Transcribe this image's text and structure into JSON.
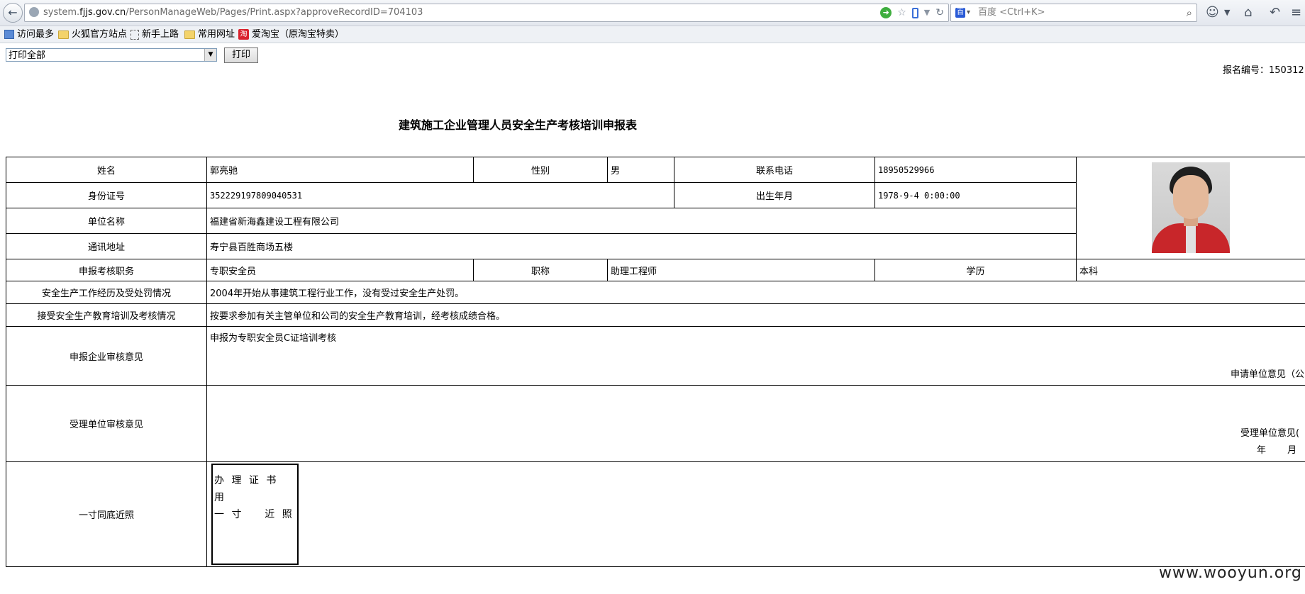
{
  "browser": {
    "url_prefix": "system.",
    "url_domain": "fjjs.gov.cn",
    "url_path": "/PersonManageWeb/Pages/Print.aspx?approveRecordID=704103",
    "search_placeholder": "百度 <Ctrl+K>"
  },
  "bookmarks": [
    {
      "label": "访问最多",
      "icon": "most-visited-icon"
    },
    {
      "label": "火狐官方站点",
      "icon": "folder-icon"
    },
    {
      "label": "新手上路",
      "icon": "page-icon"
    },
    {
      "label": "常用网址",
      "icon": "folder-icon"
    },
    {
      "label": "爱淘宝（原淘宝特卖）",
      "icon": "taobao-icon"
    }
  ],
  "toolbar": {
    "print_select_value": "打印全部",
    "print_button": "打印"
  },
  "reg_number": "报名编号：150312",
  "title": "建筑施工企业管理人员安全生产考核培训申报表",
  "form": {
    "name_label": "姓名",
    "name_value": "郭亮驰",
    "gender_label": "性别",
    "gender_value": "男",
    "phone_label": "联系电话",
    "phone_value": "18950529966",
    "id_label": "身份证号",
    "id_value": "352229197809040531",
    "birth_label": "出生年月",
    "birth_value": "1978-9-4 0:00:00",
    "company_label": "单位名称",
    "company_value": "福建省新海鑫建设工程有限公司",
    "address_label": "通讯地址",
    "address_value": "寿宁县百胜商场五楼",
    "position_label": "申报考核职务",
    "position_value": "专职安全员",
    "title_label": "职称",
    "title_value": "助理工程师",
    "edu_label": "学历",
    "edu_value": "本科",
    "experience_label": "安全生产工作经历及受处罚情况",
    "experience_value": "2004年开始从事建筑工程行业工作，没有受过安全生产处罚。",
    "training_label": "接受安全生产教育培训及考核情况",
    "training_value": "按要求参加有关主管单位和公司的安全生产教育培训，经考核成绩合格。",
    "company_review_label": "申报企业审核意见",
    "company_review_value": "申报为专职安全员C证培训考核",
    "company_review_sign": "申请单位意见（公",
    "accept_review_label": "受理单位审核意见",
    "accept_review_sign": "受理单位意见(",
    "date_line": "年 月",
    "photo_label": "一寸同底近照",
    "photo_box_lines": [
      "办 理 证 书",
      "用",
      "一 寸    近 照"
    ]
  },
  "watermark": "www.wooyun.org"
}
